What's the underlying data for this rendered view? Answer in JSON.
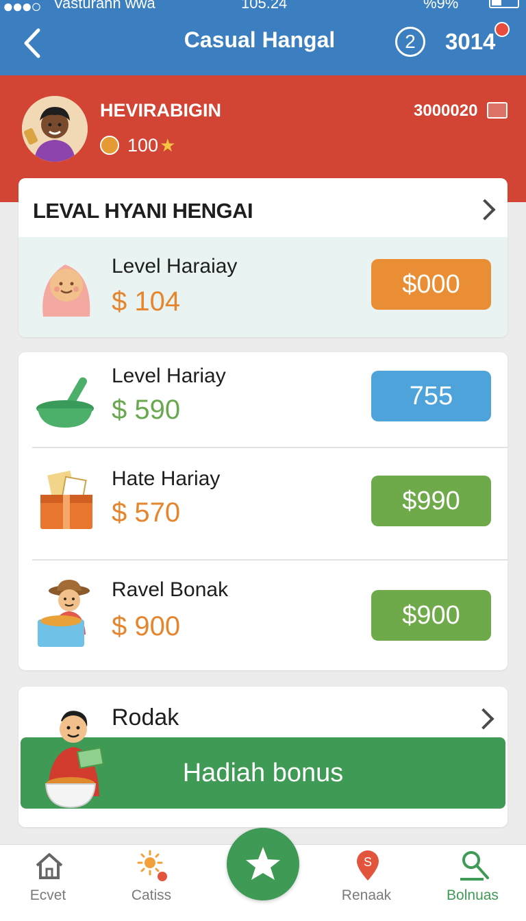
{
  "status_bar": {
    "carrier": "Vasturann  wwa",
    "time": "105.24",
    "battery": "%9%"
  },
  "header": {
    "title": "Casual Hangal",
    "counter": "2",
    "coins": "3014"
  },
  "profile": {
    "username": "HEVIRABIGIN",
    "level_points": "100",
    "balance": "3000020"
  },
  "featured": {
    "title": "LEVAL HYANI HENGAI",
    "item": {
      "label": "Level Haraiay",
      "price": "$ 104",
      "button": "$000"
    }
  },
  "offers": [
    {
      "label": "Level Hariay",
      "price": "$ 590",
      "button": "755"
    },
    {
      "label": "Hate Hariay",
      "price": "$ 570",
      "button": "$990"
    },
    {
      "label": "Ravel Bonak",
      "price": "$ 900",
      "button": "$900"
    }
  ],
  "bonus": {
    "label": "Rodak",
    "button": "Hadiah bonus"
  },
  "nav": {
    "items": [
      {
        "label": "Ecvet"
      },
      {
        "label": "Catiss"
      },
      {
        "label": "Renaak"
      },
      {
        "label": "Bolnuas"
      }
    ]
  },
  "colors": {
    "header_blue": "#3b7fc0",
    "profile_red": "#d24535",
    "accent_green": "#3f9a55",
    "price_orange": "#e5862e",
    "price_green": "#6aa84f",
    "pill_blue": "#4ea3da"
  },
  "icons": {
    "back": "back-arrow-icon",
    "wallet": "wallet-icon",
    "home": "home-icon",
    "sun": "sun-icon",
    "pin": "location-pin-icon",
    "search": "search-icon",
    "star": "star-icon"
  }
}
